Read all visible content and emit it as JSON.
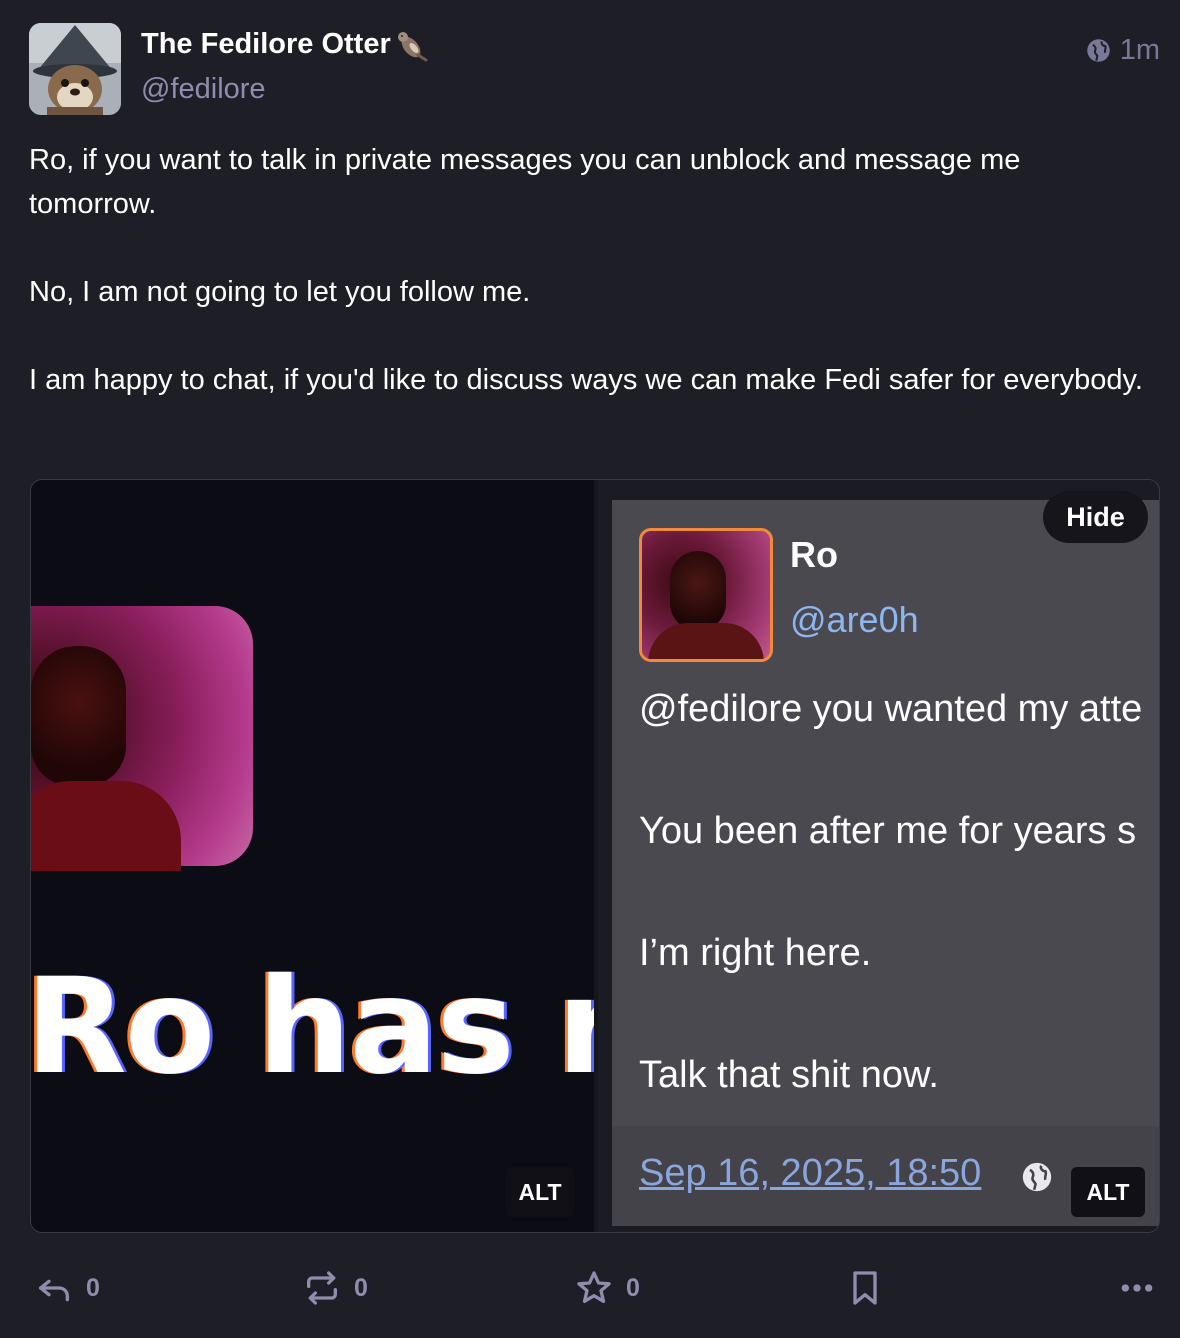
{
  "post": {
    "author": {
      "display_name": "The Fedilore Otter",
      "handle": "@fedilore",
      "name_emoji": "otter-emoji"
    },
    "visibility_icon": "globe-icon",
    "timestamp": "1m",
    "content": [
      "Ro, if you want to talk in private messages you can unblock and message me tomorrow.",
      "No, I am not going to let you follow me.",
      "I am happy to chat, if you'd like to discuss ways we can make Fedi safer for everybody."
    ],
    "media": {
      "left_image": {
        "visible_text": "Ro has rec",
        "alt_label": "ALT"
      },
      "right_image": {
        "hide_label": "Hide",
        "alt_label": "ALT",
        "quoted_post": {
          "name": "Ro",
          "handle": "@are0h",
          "lines": [
            "@fedilore you wanted my atte",
            "You been after me for years s",
            "I’m right here.",
            "Talk that shit now."
          ],
          "date": "Sep 16, 2025, 18:50"
        }
      }
    },
    "actions": {
      "reply_count": "0",
      "boost_count": "0",
      "favourite_count": "0"
    }
  }
}
